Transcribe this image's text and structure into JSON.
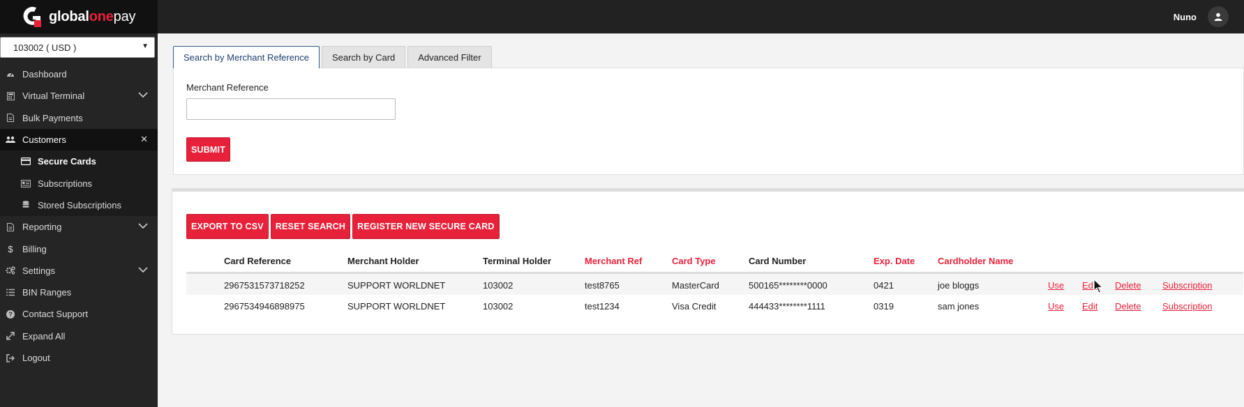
{
  "brand": {
    "part1": "global",
    "part2": "one",
    "part3": "pay"
  },
  "user": {
    "name": "Nuno"
  },
  "account_select": {
    "value": "103002 ( USD )"
  },
  "sidebar": {
    "items": [
      {
        "label": "Dashboard",
        "icon": "dashboard-icon"
      },
      {
        "label": "Virtual Terminal",
        "icon": "calculator-icon"
      },
      {
        "label": "Bulk Payments",
        "icon": "file-icon"
      },
      {
        "label": "Customers",
        "icon": "users-icon"
      },
      {
        "label": "Secure Cards",
        "icon": "credit-card-icon"
      },
      {
        "label": "Subscriptions",
        "icon": "subscription-icon"
      },
      {
        "label": "Stored Subscriptions",
        "icon": "database-icon"
      },
      {
        "label": "Reporting",
        "icon": "report-icon"
      },
      {
        "label": "Billing",
        "icon": "dollar-icon"
      },
      {
        "label": "Settings",
        "icon": "cogs-icon"
      },
      {
        "label": "BIN Ranges",
        "icon": "list-icon"
      },
      {
        "label": "Contact Support",
        "icon": "question-icon"
      },
      {
        "label": "Expand All",
        "icon": "expand-icon"
      },
      {
        "label": "Logout",
        "icon": "sign-out-icon"
      }
    ]
  },
  "tabs": [
    {
      "label": "Search by Merchant Reference"
    },
    {
      "label": "Search by Card"
    },
    {
      "label": "Advanced Filter"
    }
  ],
  "search": {
    "field_label": "Merchant Reference",
    "field_value": "",
    "submit_label": "SUBMIT"
  },
  "actions": {
    "export_label": "EXPORT TO CSV",
    "reset_label": "RESET SEARCH",
    "register_label": "REGISTER NEW SECURE CARD"
  },
  "table": {
    "headers": [
      "Card Reference",
      "Merchant Holder",
      "Terminal Holder",
      "Merchant Ref",
      "Card Type",
      "Card Number",
      "Exp. Date",
      "Cardholder Name"
    ],
    "rows": [
      {
        "card_reference": "2967531573718252",
        "merchant_holder": "SUPPORT WORLDNET",
        "terminal_holder": "103002",
        "merchant_ref": "test8765",
        "card_type": "MasterCard",
        "card_number": "500165********0000",
        "exp_date": "0421",
        "cardholder_name": "joe bloggs"
      },
      {
        "card_reference": "2967534946898975",
        "merchant_holder": "SUPPORT WORLDNET",
        "terminal_holder": "103002",
        "merchant_ref": "test1234",
        "card_type": "Visa Credit",
        "card_number": "444433********1111",
        "exp_date": "0319",
        "cardholder_name": "sam jones"
      }
    ],
    "row_actions": {
      "use": "Use",
      "edit": "Edit",
      "delete": "Delete",
      "subscription": "Subscription"
    }
  },
  "colors": {
    "accent": "#e8213a",
    "topbar": "#222222",
    "sidebar": "#252525"
  }
}
